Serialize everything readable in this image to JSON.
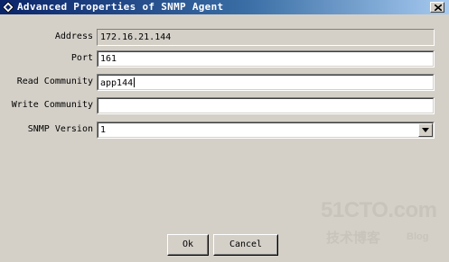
{
  "window": {
    "title": "Advanced Properties of SNMP Agent"
  },
  "form": {
    "address": {
      "label": "Address",
      "value": "172.16.21.144"
    },
    "port": {
      "label": "Port",
      "value": "161"
    },
    "read_community": {
      "label": "Read Community",
      "value": "app144"
    },
    "write_community": {
      "label": "Write Community",
      "value": ""
    },
    "snmp_version": {
      "label": "SNMP Version",
      "value": "1"
    }
  },
  "buttons": {
    "ok": "Ok",
    "cancel": "Cancel"
  },
  "watermark": {
    "main": "51CTO.com",
    "sub": "技术博客",
    "blog": "Blog"
  },
  "colors": {
    "titlebar_start": "#0a246a",
    "titlebar_end": "#a6caf0",
    "dialog_bg": "#d4d0c8"
  },
  "icons": {
    "title": "app-diamond-icon",
    "close": "close-x-icon",
    "dropdown": "chevron-down-icon"
  }
}
